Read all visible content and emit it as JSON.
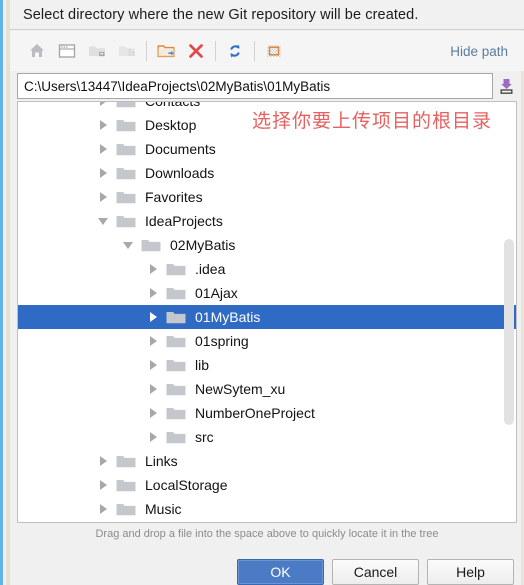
{
  "dialog": {
    "title": "Select directory where the new Git repository will be created."
  },
  "toolbar": {
    "buttons": [
      {
        "name": "home-icon",
        "title": "Home",
        "disabled": false
      },
      {
        "name": "desktop-icon",
        "title": "Desktop",
        "disabled": false
      },
      {
        "name": "drive-folder-icon",
        "title": "Drive",
        "disabled": true
      },
      {
        "name": "project-folder-icon",
        "title": "Project",
        "disabled": true
      },
      {
        "name": "new-folder-icon",
        "title": "New Folder",
        "disabled": false
      },
      {
        "name": "delete-icon",
        "title": "Delete",
        "disabled": false
      },
      {
        "name": "refresh-icon",
        "title": "Refresh",
        "disabled": false
      },
      {
        "name": "show-hidden-files-icon",
        "title": "Show Hidden Files",
        "disabled": false
      }
    ],
    "hide_path_label": "Hide path"
  },
  "path": {
    "value": "C:\\Users\\13447\\IdeaProjects\\02MyBatis\\01MyBatis",
    "placeholder": "",
    "paste_icon": "paste-path-icon"
  },
  "tree": {
    "rows": [
      {
        "label": "Contacts",
        "indent": 1,
        "arrow": "right",
        "selected": false
      },
      {
        "label": "Desktop",
        "indent": 1,
        "arrow": "right",
        "selected": false
      },
      {
        "label": "Documents",
        "indent": 1,
        "arrow": "right",
        "selected": false
      },
      {
        "label": "Downloads",
        "indent": 1,
        "arrow": "right",
        "selected": false
      },
      {
        "label": "Favorites",
        "indent": 1,
        "arrow": "right",
        "selected": false
      },
      {
        "label": "IdeaProjects",
        "indent": 1,
        "arrow": "down",
        "selected": false
      },
      {
        "label": "02MyBatis",
        "indent": 2,
        "arrow": "down",
        "selected": false
      },
      {
        "label": ".idea",
        "indent": 3,
        "arrow": "right",
        "selected": false
      },
      {
        "label": "01Ajax",
        "indent": 3,
        "arrow": "right",
        "selected": false
      },
      {
        "label": "01MyBatis",
        "indent": 3,
        "arrow": "right",
        "selected": true
      },
      {
        "label": "01spring",
        "indent": 3,
        "arrow": "right",
        "selected": false
      },
      {
        "label": "lib",
        "indent": 3,
        "arrow": "right",
        "selected": false
      },
      {
        "label": "NewSytem_xu",
        "indent": 3,
        "arrow": "right",
        "selected": false
      },
      {
        "label": "NumberOneProject",
        "indent": 3,
        "arrow": "right",
        "selected": false
      },
      {
        "label": "src",
        "indent": 3,
        "arrow": "right",
        "selected": false
      },
      {
        "label": "Links",
        "indent": 1,
        "arrow": "right",
        "selected": false
      },
      {
        "label": "LocalStorage",
        "indent": 1,
        "arrow": "right",
        "selected": false
      },
      {
        "label": "Music",
        "indent": 1,
        "arrow": "right",
        "selected": false
      }
    ]
  },
  "annotation": {
    "text": "选择你要上传项目的根目录",
    "color": "#e8605f"
  },
  "hint": {
    "text": "Drag and drop a file into the space above to quickly locate it in the tree"
  },
  "buttons": {
    "ok": "OK",
    "cancel": "Cancel",
    "help": "Help"
  },
  "colors": {
    "selection": "#2f6bc4",
    "ok_button": "#4a7bc4",
    "link": "#5c7c9e",
    "folder": "#c4c8cc"
  }
}
